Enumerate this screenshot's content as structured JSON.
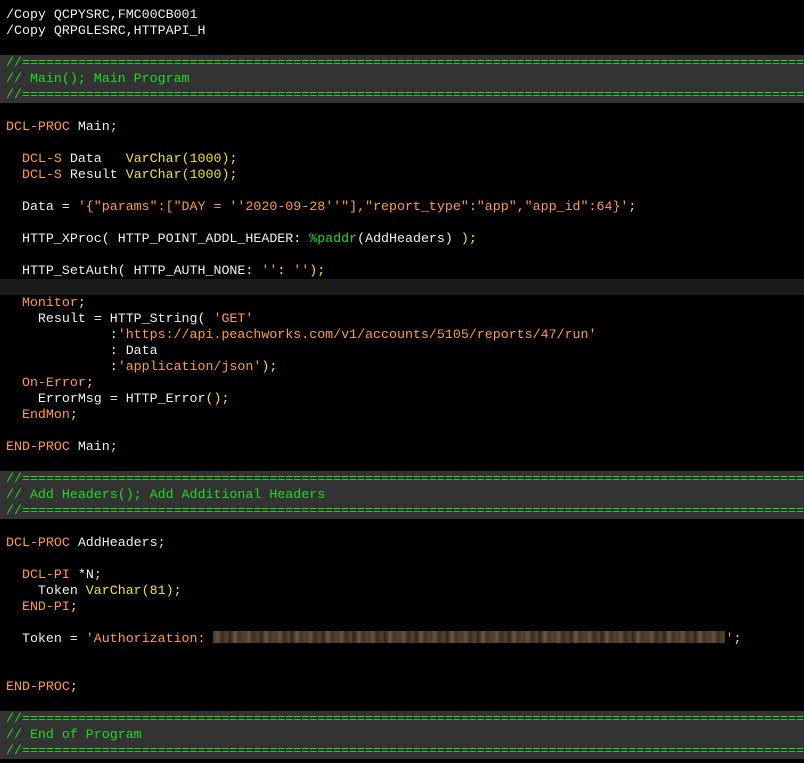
{
  "colors": {
    "background": "#000000",
    "default_text": "#f0f0f0",
    "keyword": "#ff9b4a",
    "type": "#f0e040",
    "string": "#ff9b4a",
    "builtin": "#23d823",
    "comment": "#23d823",
    "band": "#333333"
  },
  "lines": [
    {
      "band": false,
      "tokens": [
        {
          "c": "wht",
          "t": "/Copy QCPYSRC,FMC00CB001"
        }
      ]
    },
    {
      "band": false,
      "tokens": [
        {
          "c": "wht",
          "t": "/Copy QRPGLESRC,HTTPAPI_H"
        }
      ]
    },
    {
      "band": false,
      "tokens": []
    },
    {
      "band": true,
      "tokens": [
        {
          "c": "cmt",
          "t": "//======================================================================================================"
        }
      ]
    },
    {
      "band": true,
      "tokens": [
        {
          "c": "cmt",
          "t": "// Main(); Main Program"
        }
      ]
    },
    {
      "band": true,
      "tokens": [
        {
          "c": "cmt",
          "t": "//======================================================================================================"
        }
      ]
    },
    {
      "band": false,
      "tokens": []
    },
    {
      "band": false,
      "tokens": [
        {
          "c": "kw",
          "t": "DCL-PROC"
        },
        {
          "c": "wht",
          "t": " Main"
        },
        {
          "c": "pun",
          "t": ";"
        }
      ]
    },
    {
      "band": false,
      "tokens": []
    },
    {
      "band": false,
      "tokens": [
        {
          "c": "wht",
          "t": "  "
        },
        {
          "c": "kw",
          "t": "DCL-S"
        },
        {
          "c": "wht",
          "t": " Data   "
        },
        {
          "c": "ty",
          "t": "VarChar"
        },
        {
          "c": "pun",
          "t": "("
        },
        {
          "c": "ty",
          "t": "1000"
        },
        {
          "c": "pun",
          "t": ");"
        }
      ]
    },
    {
      "band": false,
      "tokens": [
        {
          "c": "wht",
          "t": "  "
        },
        {
          "c": "kw",
          "t": "DCL-S"
        },
        {
          "c": "wht",
          "t": " Result "
        },
        {
          "c": "ty",
          "t": "VarChar"
        },
        {
          "c": "pun",
          "t": "("
        },
        {
          "c": "ty",
          "t": "1000"
        },
        {
          "c": "pun",
          "t": ");"
        }
      ]
    },
    {
      "band": false,
      "tokens": []
    },
    {
      "band": false,
      "tokens": [
        {
          "c": "wht",
          "t": "  Data = "
        },
        {
          "c": "str",
          "t": "'{\"params\":[\"DAY = ''2020-09-28''\"],\"report_type\":\"app\",\"app_id\":64}'"
        },
        {
          "c": "pun",
          "t": ";"
        }
      ]
    },
    {
      "band": false,
      "tokens": []
    },
    {
      "band": false,
      "tokens": [
        {
          "c": "wht",
          "t": "  HTTP_XProc( HTTP_POINT_ADDL_HEADER: "
        },
        {
          "c": "fn",
          "t": "%paddr"
        },
        {
          "c": "wht",
          "t": "(AddHeaders) "
        },
        {
          "c": "pun",
          "t": ");"
        }
      ]
    },
    {
      "band": false,
      "tokens": []
    },
    {
      "band": false,
      "tokens": [
        {
          "c": "wht",
          "t": "  HTTP_SetAuth( HTTP_AUTH_NONE: "
        },
        {
          "c": "str",
          "t": "''"
        },
        {
          "c": "wht",
          "t": ": "
        },
        {
          "c": "str",
          "t": "''"
        },
        {
          "c": "pun",
          "t": ");"
        }
      ]
    },
    {
      "band": false,
      "current": true,
      "tokens": []
    },
    {
      "band": false,
      "tokens": [
        {
          "c": "wht",
          "t": "  "
        },
        {
          "c": "kw",
          "t": "Monitor"
        },
        {
          "c": "pun",
          "t": ";"
        }
      ]
    },
    {
      "band": false,
      "tokens": [
        {
          "c": "wht",
          "t": "    Result = HTTP_String( "
        },
        {
          "c": "str",
          "t": "'GET'"
        }
      ]
    },
    {
      "band": false,
      "tokens": [
        {
          "c": "wht",
          "t": "             :"
        },
        {
          "c": "str",
          "t": "'https://api.peachworks.com/v1/accounts/5105/reports/47/run'"
        }
      ]
    },
    {
      "band": false,
      "tokens": [
        {
          "c": "wht",
          "t": "             : Data"
        }
      ]
    },
    {
      "band": false,
      "tokens": [
        {
          "c": "wht",
          "t": "             :"
        },
        {
          "c": "str",
          "t": "'application/json'"
        },
        {
          "c": "pun",
          "t": ");"
        }
      ]
    },
    {
      "band": false,
      "tokens": [
        {
          "c": "wht",
          "t": "  "
        },
        {
          "c": "kw",
          "t": "On-Error"
        },
        {
          "c": "pun",
          "t": ";"
        }
      ]
    },
    {
      "band": false,
      "tokens": [
        {
          "c": "wht",
          "t": "    ErrorMsg = HTTP_Error"
        },
        {
          "c": "pun",
          "t": "();"
        }
      ]
    },
    {
      "band": false,
      "tokens": [
        {
          "c": "wht",
          "t": "  "
        },
        {
          "c": "kw",
          "t": "EndMon"
        },
        {
          "c": "pun",
          "t": ";"
        }
      ]
    },
    {
      "band": false,
      "tokens": []
    },
    {
      "band": false,
      "tokens": [
        {
          "c": "kw",
          "t": "END-PROC"
        },
        {
          "c": "wht",
          "t": " Main"
        },
        {
          "c": "pun",
          "t": ";"
        }
      ]
    },
    {
      "band": false,
      "tokens": []
    },
    {
      "band": true,
      "tokens": [
        {
          "c": "cmt",
          "t": "//======================================================================================================"
        }
      ]
    },
    {
      "band": true,
      "tokens": [
        {
          "c": "cmt",
          "t": "// Add Headers(); Add Additional Headers"
        }
      ]
    },
    {
      "band": true,
      "tokens": [
        {
          "c": "cmt",
          "t": "//======================================================================================================"
        }
      ]
    },
    {
      "band": false,
      "tokens": []
    },
    {
      "band": false,
      "tokens": [
        {
          "c": "kw",
          "t": "DCL-PROC"
        },
        {
          "c": "wht",
          "t": " AddHeaders"
        },
        {
          "c": "pun",
          "t": ";"
        }
      ]
    },
    {
      "band": false,
      "tokens": []
    },
    {
      "band": false,
      "tokens": [
        {
          "c": "wht",
          "t": "  "
        },
        {
          "c": "kw",
          "t": "DCL-PI"
        },
        {
          "c": "wht",
          "t": " *N"
        },
        {
          "c": "pun",
          "t": ";"
        }
      ]
    },
    {
      "band": false,
      "tokens": [
        {
          "c": "wht",
          "t": "    Token "
        },
        {
          "c": "ty",
          "t": "VarChar"
        },
        {
          "c": "pun",
          "t": "("
        },
        {
          "c": "ty",
          "t": "81"
        },
        {
          "c": "pun",
          "t": ");"
        }
      ]
    },
    {
      "band": false,
      "tokens": [
        {
          "c": "wht",
          "t": "  "
        },
        {
          "c": "kw",
          "t": "END-PI"
        },
        {
          "c": "pun",
          "t": ";"
        }
      ]
    },
    {
      "band": false,
      "tokens": []
    },
    {
      "band": false,
      "tokens": [
        {
          "c": "wht",
          "t": "  Token = "
        },
        {
          "c": "str",
          "t": "'Authorization: "
        },
        {
          "c": "redacted",
          "t": ""
        },
        {
          "c": "str",
          "t": "'"
        },
        {
          "c": "pun",
          "t": ";"
        }
      ]
    },
    {
      "band": false,
      "tokens": []
    },
    {
      "band": false,
      "tokens": []
    },
    {
      "band": false,
      "tokens": [
        {
          "c": "kw",
          "t": "END-PROC"
        },
        {
          "c": "pun",
          "t": ";"
        }
      ]
    },
    {
      "band": false,
      "tokens": []
    },
    {
      "band": true,
      "tokens": [
        {
          "c": "cmt",
          "t": "//======================================================================================================"
        }
      ]
    },
    {
      "band": true,
      "tokens": [
        {
          "c": "cmt",
          "t": "// End of Program"
        }
      ]
    },
    {
      "band": true,
      "tokens": [
        {
          "c": "cmt",
          "t": "//======================================================================================================"
        }
      ]
    }
  ]
}
